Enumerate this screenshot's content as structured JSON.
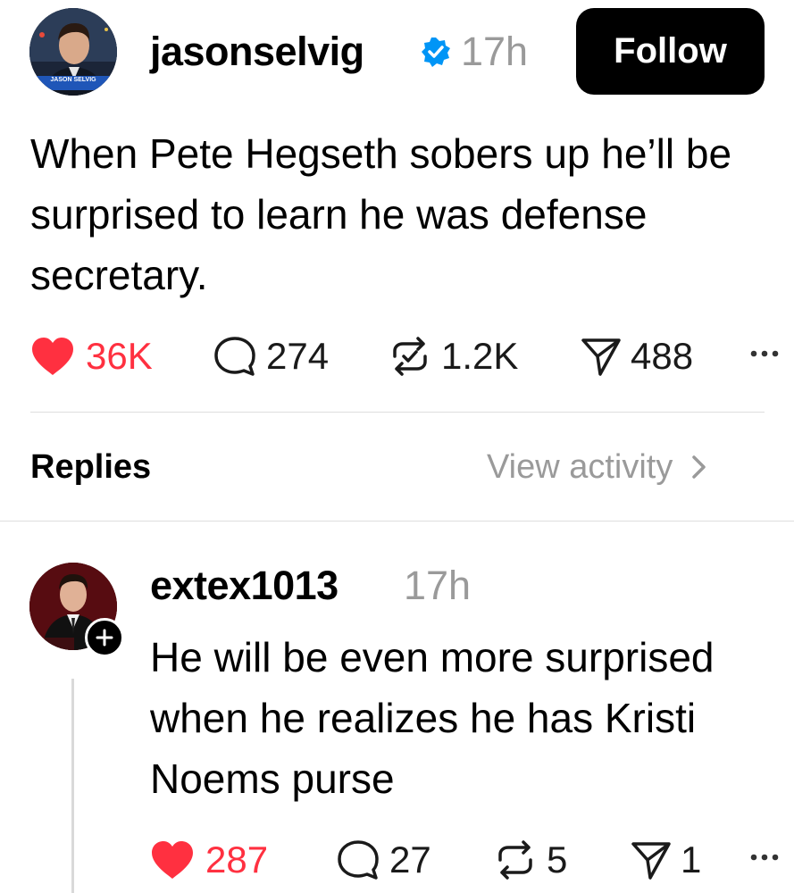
{
  "post": {
    "username": "jasonselvig",
    "time": "17h",
    "follow_label": "Follow",
    "avatar_caption": "JASON SELVIG",
    "text": "When Pete Hegseth sobers up he’ll be surprised to learn he was defense secretary.",
    "likes": "36K",
    "comments": "274",
    "reposts": "1.2K",
    "shares": "488"
  },
  "replies_header": {
    "label": "Replies",
    "view_activity": "View activity"
  },
  "reply": {
    "username": "extex1013",
    "time": "17h",
    "text": "He will be even more surprised when he realizes he has Kristi Noems purse",
    "likes": "287",
    "comments": "27",
    "reposts": "5",
    "shares": "1"
  },
  "colors": {
    "like_red": "#ff3040",
    "verified_blue": "#0095f6",
    "muted_gray": "#9a9a9a"
  },
  "icons": [
    "heart-icon",
    "comment-icon",
    "repost-icon",
    "share-icon",
    "more-icon",
    "verified-icon",
    "chevron-right-icon",
    "plus-icon"
  ]
}
